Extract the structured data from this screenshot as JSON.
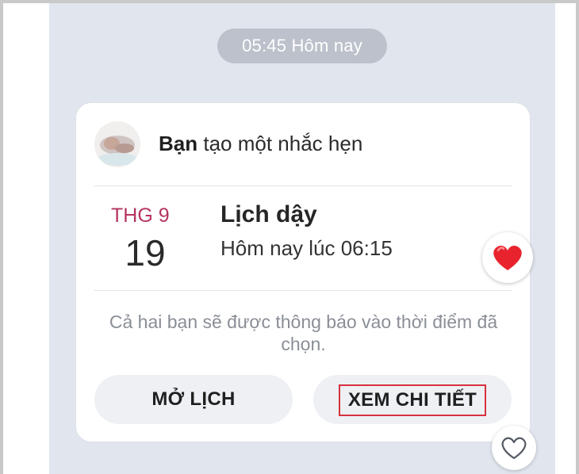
{
  "timestamp": "05:45 Hôm nay",
  "reminder": {
    "actor": "Bạn",
    "action": "tạo một nhắc hẹn",
    "month": "THG 9",
    "day": "19",
    "title": "Lịch dậy",
    "time": "Hôm nay lúc 06:15",
    "notice": "Cả hai bạn sẽ được thông báo vào thời điểm đã chọn.",
    "buttons": {
      "open_calendar": "MỞ LỊCH",
      "view_detail": "XEM CHI TIẾT"
    }
  },
  "reactions": {
    "filled": "heart-icon",
    "outline": "heart-outline-icon"
  },
  "colors": {
    "month_accent": "#b5345e",
    "heart": "#e8232e",
    "highlight_border": "#d8323f"
  }
}
